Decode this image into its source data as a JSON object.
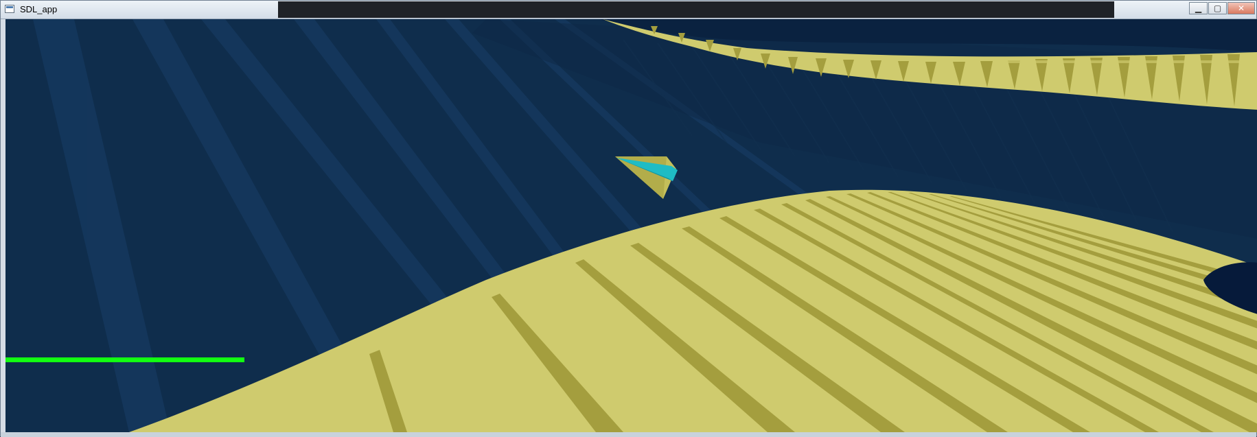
{
  "window": {
    "title": "SDL_app",
    "buttons": {
      "minimize": "▁",
      "maximize": "▢",
      "close": "✕"
    }
  },
  "game": {
    "health_fraction": 0.36,
    "colors": {
      "sky": "#0f2d4c",
      "sky_ray": "#163a60",
      "track": "#cfcb6e",
      "track_shadow": "#a49e3e",
      "ship_body": "#c4bf5a",
      "ship_fin": "#1fbcc4",
      "health": "#12ff12"
    }
  }
}
